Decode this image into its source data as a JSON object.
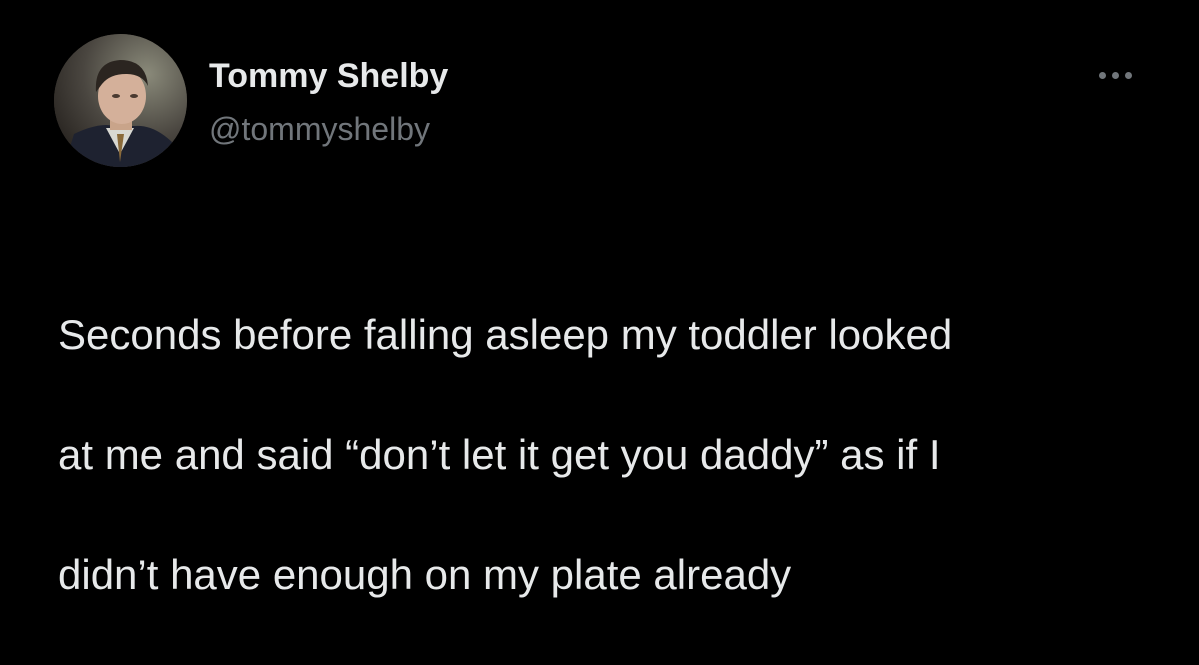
{
  "tweet": {
    "author": {
      "display_name": "Tommy Shelby",
      "handle": "@tommyshelby",
      "avatar_icon": "profile-photo"
    },
    "more_icon": "more-horizontal-icon",
    "text_lines": [
      "Seconds before falling asleep my toddler looked",
      "at me and said “don’t let it get you daddy” as if I",
      "didn’t have enough on my plate already"
    ]
  },
  "colors": {
    "background": "#000000",
    "primary_text": "#e7e9ea",
    "secondary_text": "#71767b"
  }
}
